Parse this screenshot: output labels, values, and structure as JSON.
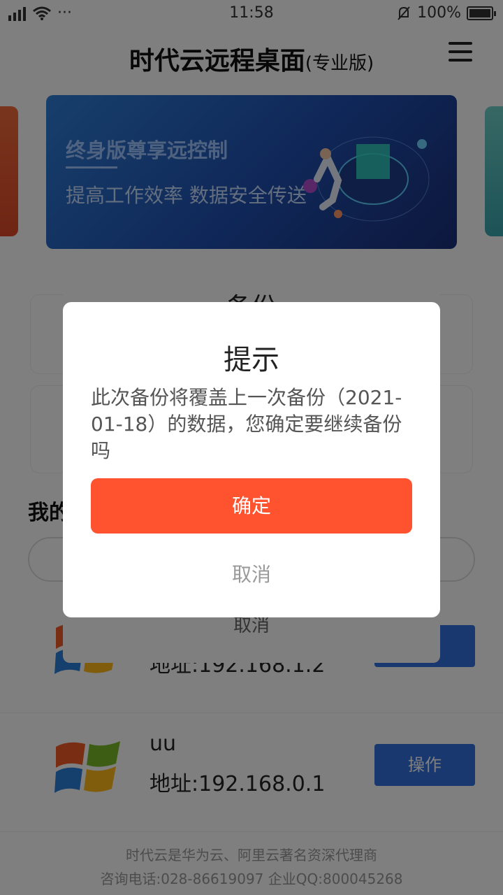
{
  "status_bar": {
    "time": "11:58",
    "battery": "100%",
    "dots": "···"
  },
  "header": {
    "title": "时代云远程桌面",
    "edition": "(专业版)"
  },
  "banner": {
    "line1": "终身版尊享远控制",
    "line2": "提高工作效率 数据安全传送"
  },
  "background": {
    "my_label": "我的",
    "sheet_title": "备份",
    "sheet_cancel": "取消",
    "devices": [
      {
        "name": "",
        "address": "地址:192.168.1.2",
        "action": ""
      },
      {
        "name": "uu",
        "address": "地址:192.168.0.1",
        "action": "操作"
      }
    ],
    "footer_line1": "时代云是华为云、阿里云著名资深代理商",
    "footer_line2": "咨询电话:028-86619097 企业QQ:800045268"
  },
  "dialog": {
    "title": "提示",
    "message": "此次备份将覆盖上一次备份（2021-01-18）的数据，您确定要继续备份吗",
    "confirm_label": "确定",
    "cancel_label": "取消"
  },
  "colors": {
    "confirm": "#ff532f",
    "action_button": "#3370e0"
  }
}
